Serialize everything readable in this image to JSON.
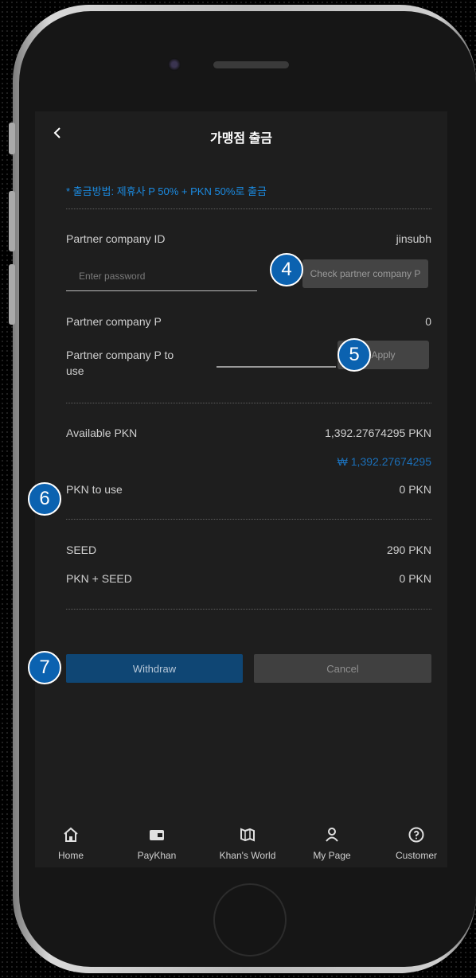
{
  "header": {
    "back_icon": "chevron-left-icon",
    "title": "가맹점 출금"
  },
  "notice": "* 출금방법: 제휴사 P 50% + PKN 50%로 출금",
  "partner": {
    "id_label": "Partner company ID",
    "id_value": "jinsubh",
    "password_placeholder": "Enter password",
    "check_button": "Check partner company P",
    "p_label": "Partner company P",
    "p_value": "0",
    "p_use_label": "Partner company P to use",
    "apply_button": "Apply"
  },
  "pkn": {
    "available_label": "Available PKN",
    "available_value": "1,392.27674295 PKN",
    "available_krw": "₩ 1,392.27674295",
    "use_label": "PKN to use",
    "use_value": "0 PKN"
  },
  "seed": {
    "seed_label": "SEED",
    "seed_value": "290 PKN",
    "sum_label": "PKN + SEED",
    "sum_value": "0 PKN"
  },
  "actions": {
    "withdraw": "Withdraw",
    "cancel": "Cancel"
  },
  "badges": {
    "b4": "4",
    "b5": "5",
    "b6": "6",
    "b7": "7"
  },
  "tabbar": [
    {
      "label": "Home",
      "icon": "home-icon"
    },
    {
      "label": "PayKhan",
      "icon": "wallet-icon"
    },
    {
      "label": "Khan's World",
      "icon": "map-book-icon"
    },
    {
      "label": "My Page",
      "icon": "user-icon"
    },
    {
      "label": "Customer",
      "icon": "question-circle-icon"
    }
  ],
  "colors": {
    "accent": "#1b8ae0",
    "primary_button": "#0f4674",
    "badge": "#0b62b0",
    "screen_bg": "#1e1e1e"
  }
}
